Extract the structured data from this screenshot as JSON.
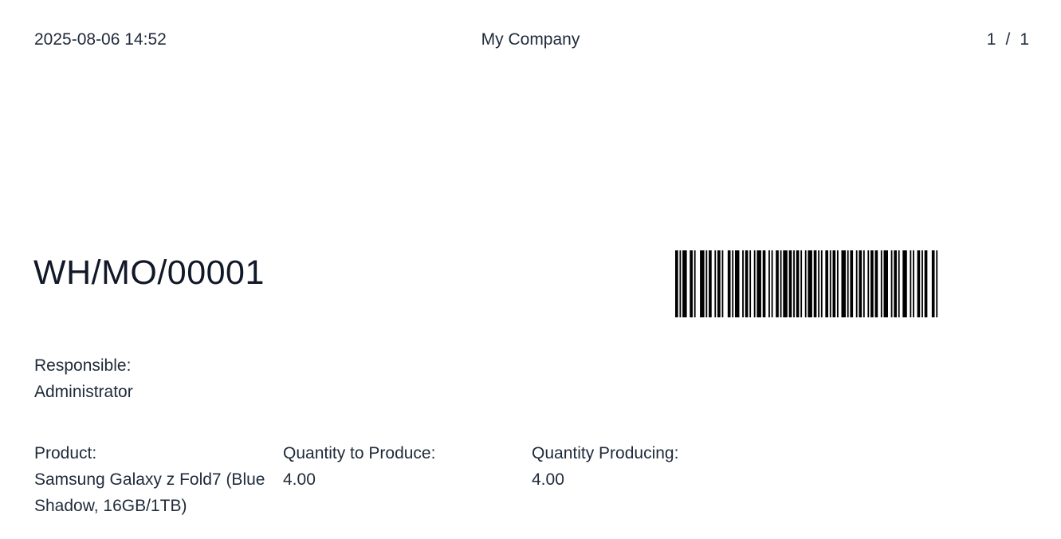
{
  "header": {
    "datetime": "2025-08-06 14:52",
    "company": "My Company",
    "page_current": "1",
    "page_separator": "/",
    "page_total": "1"
  },
  "document": {
    "reference": "WH/MO/00001",
    "barcode_value": "WH/MO/00001"
  },
  "responsible": {
    "label": "Responsible:",
    "value": "Administrator"
  },
  "details": {
    "product_label": "Product:",
    "product_value": "Samsung Galaxy z Fold7 (Blue Shadow, 16GB/1TB)",
    "qty_to_produce_label": "Quantity to Produce:",
    "qty_to_produce_value": "4.00",
    "qty_producing_label": "Quantity Producing:",
    "qty_producing_value": "4.00"
  }
}
